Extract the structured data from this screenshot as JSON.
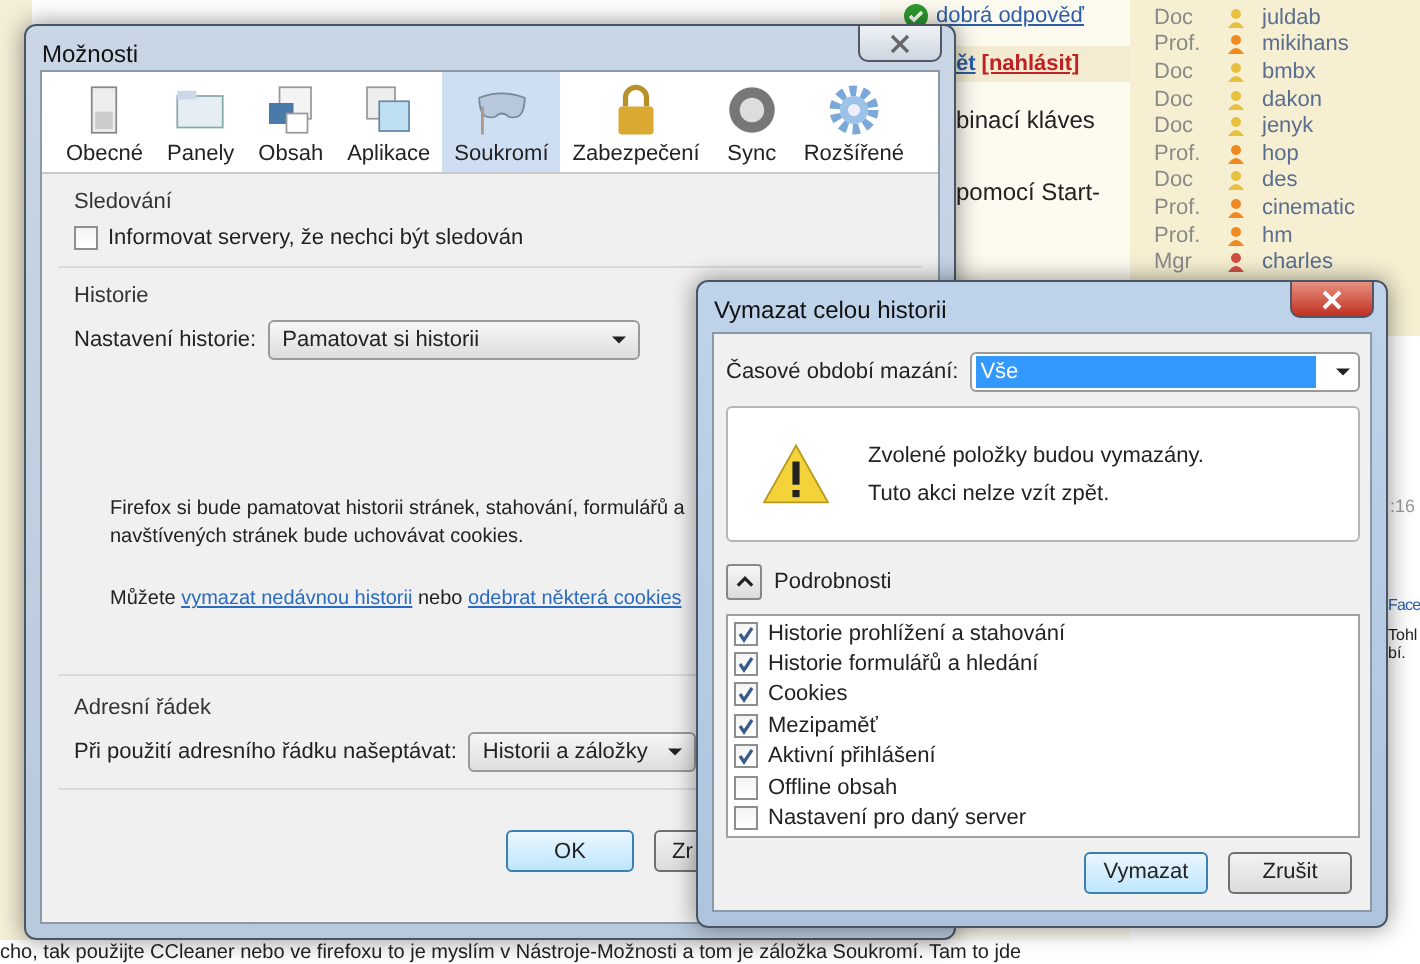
{
  "background_page": {
    "answer_link": "dobrá odpověď",
    "post_action": "ět",
    "report_link": "[nahlásit]",
    "text_fragments": [
      "binací kláves",
      "pomocí Start-"
    ],
    "users": [
      {
        "title": "Doc",
        "name": "juldab",
        "color": "#e8c040"
      },
      {
        "title": "Prof.",
        "name": "mikihans",
        "color": "#f08a20"
      },
      {
        "title": "Doc",
        "name": "bmbx",
        "color": "#e8c040"
      },
      {
        "title": "Doc",
        "name": "dakon",
        "color": "#e8c040"
      },
      {
        "title": "Doc",
        "name": "jenyk",
        "color": "#e8c040"
      },
      {
        "title": "Prof.",
        "name": "hop",
        "color": "#f08a20"
      },
      {
        "title": "Doc",
        "name": "des",
        "color": "#e8c040"
      },
      {
        "title": "Prof.",
        "name": "cinematic",
        "color": "#f08a20"
      },
      {
        "title": "Prof.",
        "name": "hm",
        "color": "#f08a20"
      },
      {
        "title": "Mgr",
        "name": "charles",
        "color": "#d05040"
      }
    ],
    "time": ":16",
    "side_fragments": [
      "Face",
      "Tohl",
      "bí."
    ],
    "bottom_text": "cho, tak použijte CCleaner nebo ve firefoxu to je myslím v Nástroje-Možnosti a tom je záložka Soukromí. Tam to jde"
  },
  "options_window": {
    "title": "Možnosti",
    "tabs": [
      {
        "label": "Obecné",
        "selected": false
      },
      {
        "label": "Panely",
        "selected": false
      },
      {
        "label": "Obsah",
        "selected": false
      },
      {
        "label": "Aplikace",
        "selected": false
      },
      {
        "label": "Soukromí",
        "selected": true
      },
      {
        "label": "Zabezpečení",
        "selected": false
      },
      {
        "label": "Sync",
        "selected": false
      },
      {
        "label": "Rozšířené",
        "selected": false
      }
    ],
    "tracking": {
      "heading": "Sledování",
      "checkbox": {
        "label": "Informovat servery, že nechci být sledován",
        "checked": false
      }
    },
    "history": {
      "heading": "Historie",
      "label": "Nastavení historie:",
      "value": "Pamatovat si historii",
      "description": [
        "Firefox si bude pamatovat historii stránek, stahování, formulářů a",
        "navštívených stránek bude uchovávat cookies."
      ],
      "links_prefix": "Můžete",
      "link_1": "vymazat nedávnou historii",
      "links_middle": "nebo",
      "link_2": "odebrat některá cookies"
    },
    "address_bar": {
      "heading": "Adresní řádek",
      "label": "Při použití adresního řádku našeptávat:",
      "value": "Historii a záložky"
    },
    "buttons": [
      "OK",
      "Zr"
    ]
  },
  "clear_dialog": {
    "title": "Vymazat celou historii",
    "range_label": "Časové období mazání:",
    "range_value": "Vše",
    "warning": [
      "Zvolené položky budou vymazány.",
      "Tuto akci nelze vzít zpět."
    ],
    "details": {
      "label": "Podrobnosti",
      "expanded": true
    },
    "items": [
      {
        "label": "Historie prohlížení a stahování",
        "checked": true
      },
      {
        "label": "Historie formulářů a hledání",
        "checked": true
      },
      {
        "label": "Cookies",
        "checked": true
      },
      {
        "label": "Mezipaměť",
        "checked": true
      },
      {
        "label": "Aktivní přihlášení",
        "checked": true
      },
      {
        "label": "Offline obsah",
        "checked": false
      },
      {
        "label": "Nastavení pro daný server",
        "checked": false
      }
    ],
    "buttons": [
      "Vymazat",
      "Zrušit"
    ]
  }
}
